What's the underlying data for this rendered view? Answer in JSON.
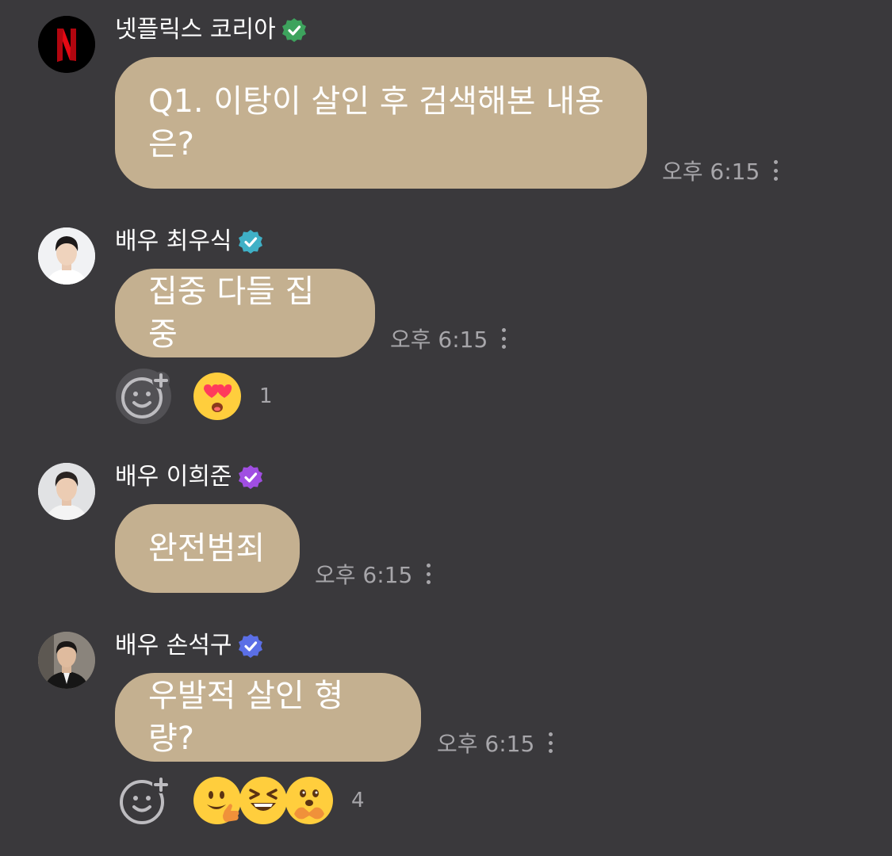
{
  "messages": [
    {
      "sender": "넷플릭스 코리아",
      "text": "Q1. 이탕이 살인 후 검색해본 내용\n은?",
      "time": "오후 6:15",
      "badge_color": "#3da35d",
      "avatar_icon": "netflix-logo-icon"
    },
    {
      "sender": "배우 최우식",
      "text": "집중 다들 집중",
      "time": "오후 6:15",
      "badge_color": "#3fb0c6",
      "avatar_icon": "avatar-portrait-icon",
      "reaction_count": "1",
      "reaction_icons": [
        "heart-eyes-emoji-icon"
      ]
    },
    {
      "sender": "배우 이희준",
      "text": "완전범죄",
      "time": "오후 6:15",
      "badge_color": "#a04ee2",
      "avatar_icon": "avatar-portrait-icon"
    },
    {
      "sender": "배우 손석구",
      "text": "우발적 살인 형량?",
      "time": "오후 6:15",
      "badge_color": "#5b6fe6",
      "avatar_icon": "avatar-portrait-icon",
      "reaction_count": "4",
      "reaction_icons": [
        "thumbs-up-emoji-icon",
        "laughing-emoji-icon",
        "hands-together-emoji-icon"
      ]
    }
  ],
  "colors": {
    "background": "#3a393c",
    "bubble": "#c4b090",
    "meta_text": "#a7a6aa"
  }
}
